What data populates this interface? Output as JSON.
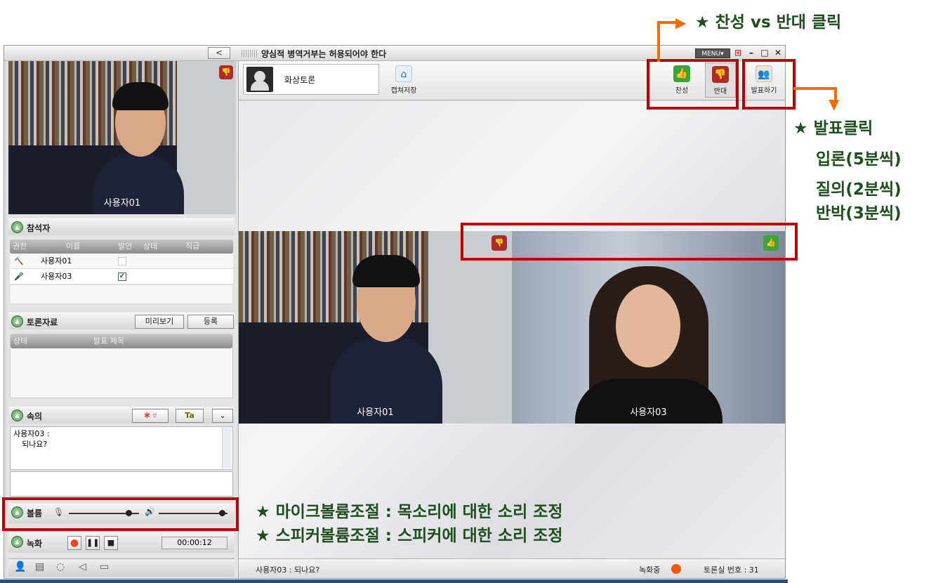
{
  "window": {
    "title": "양심적 병역거부는 허용되어야 한다",
    "menu_label": "MENU▾",
    "collapse_symbol": "<"
  },
  "left_panel": {
    "self_video_label": "사용자01",
    "participants": {
      "title": "참석자",
      "columns": [
        "권한",
        "이름",
        "발언",
        "상태",
        "직급"
      ],
      "rows": [
        {
          "name": "사용자01",
          "speak": false
        },
        {
          "name": "사용자03",
          "speak": true
        }
      ]
    },
    "materials": {
      "title": "토론자료",
      "preview_label": "미리보기",
      "register_label": "등록",
      "columns": [
        "상태",
        "발표 제목"
      ]
    },
    "whisper": {
      "title": "속의",
      "messages": [
        "사용자03 :",
        "되나요?"
      ],
      "font_btn": "Ta"
    },
    "volume": {
      "title": "볼륨",
      "mic_level": 0.85,
      "speaker_level": 0.92
    },
    "recording": {
      "title": "녹화",
      "time": "00:00:12"
    }
  },
  "toolbar": {
    "video_debate_label": "화상토론",
    "capture_label": "캡쳐저장",
    "agree_label": "찬성",
    "oppose_label": "반대",
    "present_label": "발표하기"
  },
  "videos": [
    {
      "label": "사용자01",
      "stance": "oppose"
    },
    {
      "label": "사용자03",
      "stance": "agree"
    }
  ],
  "statusbar": {
    "chat_text": "사용자03 : 되나요?",
    "recording_label": "녹화중",
    "room_label": "토론실 번호 : 31"
  },
  "annotations": {
    "top": "★ 찬성 vs 반대 클릭",
    "present_title": "★ 발표클릭",
    "present_lines": [
      "입론(5분씩)",
      "질의(2분씩)",
      "반박(3분씩)"
    ],
    "mic": "★ 마이크볼륨조절 : 목소리에 대한 소리 조정",
    "speaker": "★ 스피커볼륨조절 : 스피커에 대한 소리 조정"
  },
  "colors": {
    "highlight": "#c00000",
    "arrow": "#ff6a00",
    "annotation_text": "#1f4e1f",
    "agree": "#3aa53a",
    "oppose": "#b02a2a"
  }
}
